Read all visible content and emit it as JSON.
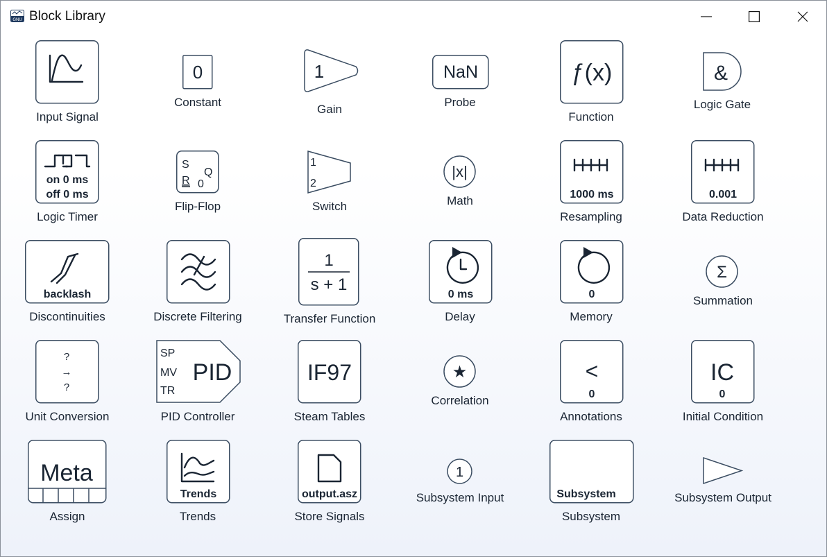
{
  "window": {
    "title": "Block Library",
    "app_icon_text": "GNU"
  },
  "blocks": {
    "input_signal": {
      "label": "Input Signal"
    },
    "constant": {
      "label": "Constant",
      "value": "0"
    },
    "gain": {
      "label": "Gain",
      "value": "1"
    },
    "probe": {
      "label": "Probe",
      "value": "NaN"
    },
    "function": {
      "label": "Function",
      "symbol": "ƒ(x)"
    },
    "logic_gate": {
      "label": "Logic Gate",
      "symbol": "&"
    },
    "logic_timer": {
      "label": "Logic Timer",
      "on": "on 0 ms",
      "off": "off 0 ms"
    },
    "flip_flop": {
      "label": "Flip-Flop",
      "s": "S",
      "r": "R",
      "q": "Q",
      "zero": "0"
    },
    "switch": {
      "label": "Switch",
      "in1": "1",
      "in2": "2"
    },
    "math": {
      "label": "Math",
      "symbol": "|x|"
    },
    "resampling": {
      "label": "Resampling",
      "value": "1000 ms"
    },
    "data_reduction": {
      "label": "Data Reduction",
      "value": "0.001"
    },
    "discontinuities": {
      "label": "Discontinuities",
      "value": "backlash"
    },
    "discrete_filtering": {
      "label": "Discrete Filtering"
    },
    "transfer_function": {
      "label": "Transfer Function",
      "numerator": "1",
      "denominator": "s + 1"
    },
    "delay": {
      "label": "Delay",
      "value": "0 ms"
    },
    "memory": {
      "label": "Memory",
      "value": "0"
    },
    "summation": {
      "label": "Summation",
      "symbol": "Σ"
    },
    "unit_conversion": {
      "label": "Unit Conversion",
      "top": "?",
      "arrow": "→",
      "bottom": "?"
    },
    "pid_controller": {
      "label": "PID Controller",
      "sp": "SP",
      "mv": "MV",
      "tr": "TR",
      "name": "PID"
    },
    "steam_tables": {
      "label": "Steam Tables",
      "value": "IF97"
    },
    "correlation": {
      "label": "Correlation",
      "symbol": "★"
    },
    "annotations": {
      "label": "Annotations",
      "symbol": "<",
      "value": "0"
    },
    "initial_condition": {
      "label": "Initial Condition",
      "symbol": "IC",
      "value": "0"
    },
    "assign": {
      "label": "Assign",
      "value": "Meta"
    },
    "trends": {
      "label": "Trends",
      "value": "Trends"
    },
    "store_signals": {
      "label": "Store Signals",
      "value": "output.asz"
    },
    "subsystem_input": {
      "label": "Subsystem Input",
      "value": "1"
    },
    "subsystem": {
      "label": "Subsystem",
      "value": "Subsystem"
    },
    "subsystem_output": {
      "label": "Subsystem Output"
    }
  }
}
